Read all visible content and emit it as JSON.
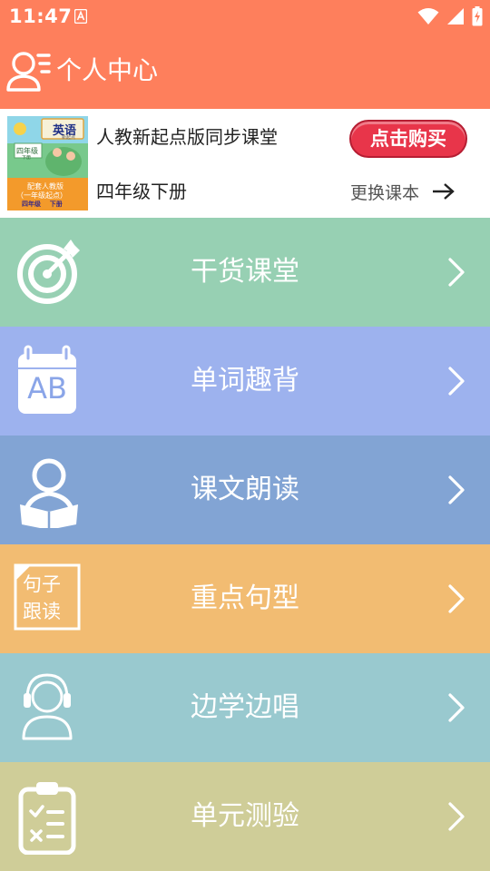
{
  "status_bar": {
    "time": "11:47",
    "notification_icon": "app-notification-icon",
    "icons": [
      "wifi-icon",
      "cellular-signal-icon",
      "battery-charging-icon"
    ]
  },
  "header": {
    "title": "个人中心",
    "icon": "user-profile-icon",
    "color": "#fe7f5c"
  },
  "book": {
    "title": "人教新起点版同步课堂",
    "grade": "四年级下册",
    "buy_label": "点击购买",
    "change_label": "更换课本",
    "cover": {
      "subject": "英语",
      "publisher": "新起点",
      "grade": "四年级",
      "term": "下册",
      "caption_line1": "配套人教版",
      "caption_line2": "（一年级起点）",
      "caption_line3": "四年级    下册"
    }
  },
  "menu": [
    {
      "label": "干货课堂",
      "icon": "target-icon",
      "color": "#97d0b3"
    },
    {
      "label": "单词趣背",
      "icon": "vocabulary-card-icon",
      "icon_text": "AB",
      "color": "#9db2ee"
    },
    {
      "label": "课文朗读",
      "icon": "reader-icon",
      "color": "#82a4d4"
    },
    {
      "label": "重点句型",
      "icon": "sentence-card-icon",
      "icon_text_line1": "句子",
      "icon_text_line2": "跟读",
      "color": "#f2bc72"
    },
    {
      "label": "边学边唱",
      "icon": "headphones-user-icon",
      "color": "#99c9cf"
    },
    {
      "label": "单元测验",
      "icon": "clipboard-quiz-icon",
      "color": "#cfcd98"
    }
  ]
}
